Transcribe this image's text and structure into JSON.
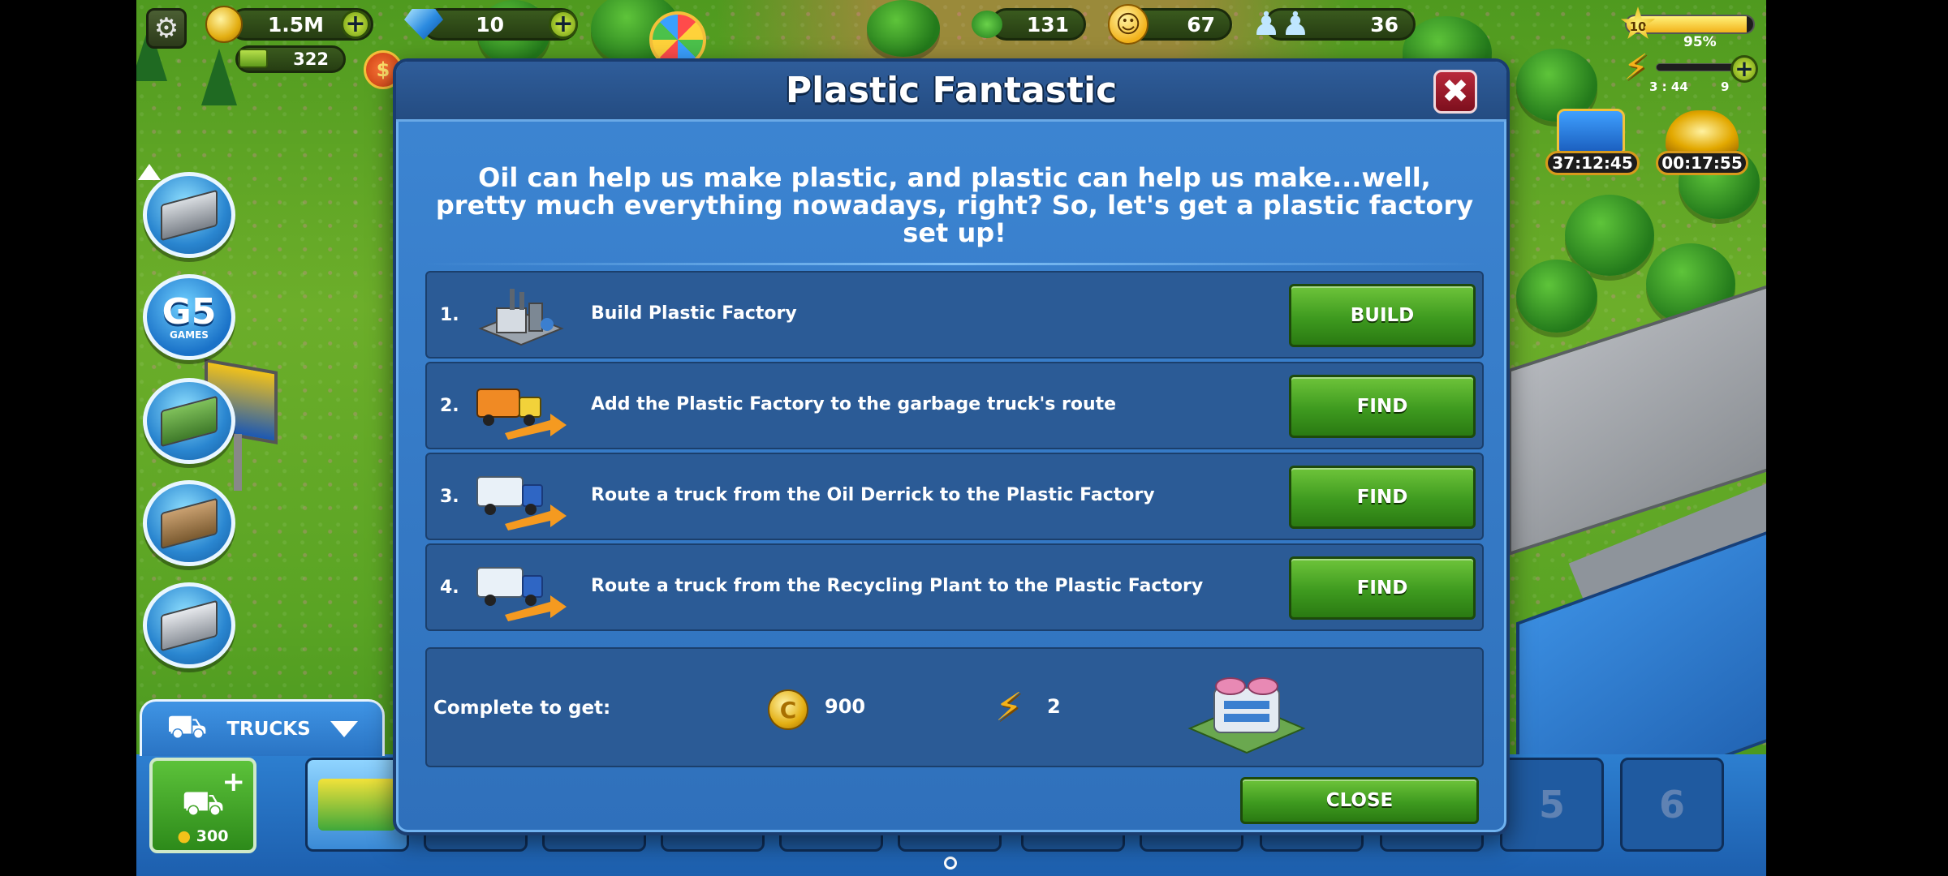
{
  "hud": {
    "coins": "1.5M",
    "gems": "10",
    "bills": "322",
    "trees": "131",
    "happiness": "67",
    "population": "36",
    "level": "10",
    "xp_percent": "95%",
    "xp_fraction": 0.95,
    "energy_timer": "3 : 44",
    "energy": "9",
    "chest_timer": "37:12:45",
    "gold_timer": "00:17:55"
  },
  "left_panel": {
    "g5_label": "G5",
    "g5_sub": "GAMES"
  },
  "modal": {
    "title": "Plastic Fantastic",
    "intro": "Oil can help us make plastic, and plastic can help us make...well, pretty much everything nowadays, right? So, let's get a plastic factory set up!",
    "tasks": [
      {
        "num": "1.",
        "text": "Build Plastic Factory",
        "button": "BUILD"
      },
      {
        "num": "2.",
        "text": "Add the Plastic Factory to the garbage truck's route",
        "button": "FIND"
      },
      {
        "num": "3.",
        "text": "Route a truck from the Oil Derrick to the Plastic Factory",
        "button": "FIND"
      },
      {
        "num": "4.",
        "text": "Route a truck from the Recycling Plant to the Plastic Factory",
        "button": "FIND"
      }
    ],
    "reward": {
      "label": "Complete to get:",
      "coins": "900",
      "energy": "2"
    },
    "close_label": "CLOSE"
  },
  "bottom": {
    "trucks_label": "TRUCKS",
    "add_truck_price": "300",
    "slot5": "5",
    "slot6": "6"
  }
}
